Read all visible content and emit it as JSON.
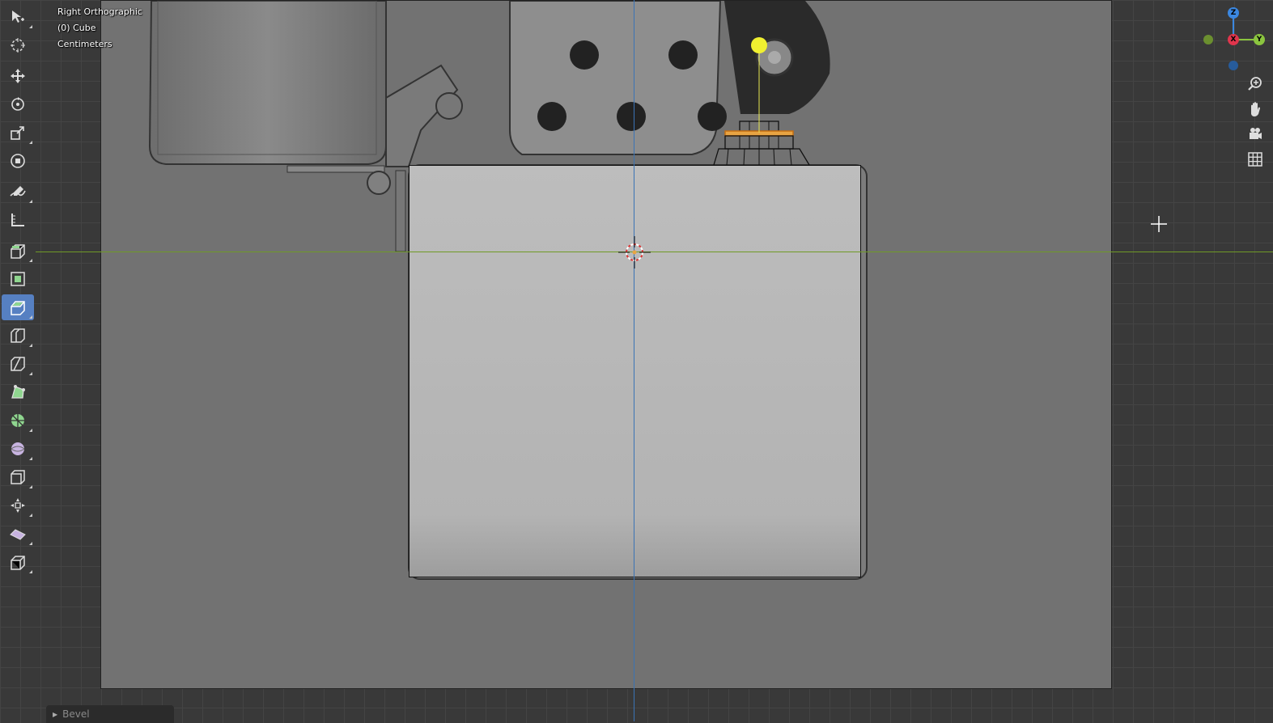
{
  "viewport": {
    "view_name": "Right Orthographic",
    "object_info": "(0) Cube",
    "units": "Centimeters"
  },
  "toolbar": {
    "tools": [
      {
        "name": "select-box",
        "icon": "select-box-icon",
        "active": false
      },
      {
        "name": "cursor",
        "icon": "cursor-icon",
        "active": false
      },
      {
        "name": "move",
        "icon": "move-icon",
        "active": false
      },
      {
        "name": "rotate",
        "icon": "rotate-icon",
        "active": false
      },
      {
        "name": "scale",
        "icon": "scale-icon",
        "active": false
      },
      {
        "name": "transform",
        "icon": "transform-icon",
        "active": false
      },
      {
        "name": "annotate",
        "icon": "annotate-icon",
        "active": false
      },
      {
        "name": "measure",
        "icon": "measure-icon",
        "active": false
      },
      {
        "name": "extrude-region",
        "icon": "extrude-icon",
        "active": false
      },
      {
        "name": "inset-faces",
        "icon": "inset-icon",
        "active": false
      },
      {
        "name": "bevel",
        "icon": "bevel-icon",
        "active": true
      },
      {
        "name": "loop-cut",
        "icon": "loop-cut-icon",
        "active": false
      },
      {
        "name": "knife",
        "icon": "knife-icon",
        "active": false
      },
      {
        "name": "poly-build",
        "icon": "poly-build-icon",
        "active": false
      },
      {
        "name": "spin",
        "icon": "spin-icon",
        "active": false
      },
      {
        "name": "smooth",
        "icon": "smooth-icon",
        "active": false
      },
      {
        "name": "edge-slide",
        "icon": "edge-slide-icon",
        "active": false
      },
      {
        "name": "shrink-fatten",
        "icon": "shrink-fatten-icon",
        "active": false
      },
      {
        "name": "shear",
        "icon": "shear-icon",
        "active": false
      },
      {
        "name": "rip-region",
        "icon": "rip-icon",
        "active": false
      }
    ]
  },
  "gizmo": {
    "z_label": "Z",
    "x_label": "X",
    "y_label": "Y",
    "colors": {
      "x": "#e0354c",
      "y": "#8bc53f",
      "z": "#3b87e0"
    }
  },
  "nav_buttons": [
    "zoom-icon",
    "pan-hand-icon",
    "camera-icon",
    "grid-icon"
  ],
  "operator_panel": {
    "label": "Bevel"
  }
}
